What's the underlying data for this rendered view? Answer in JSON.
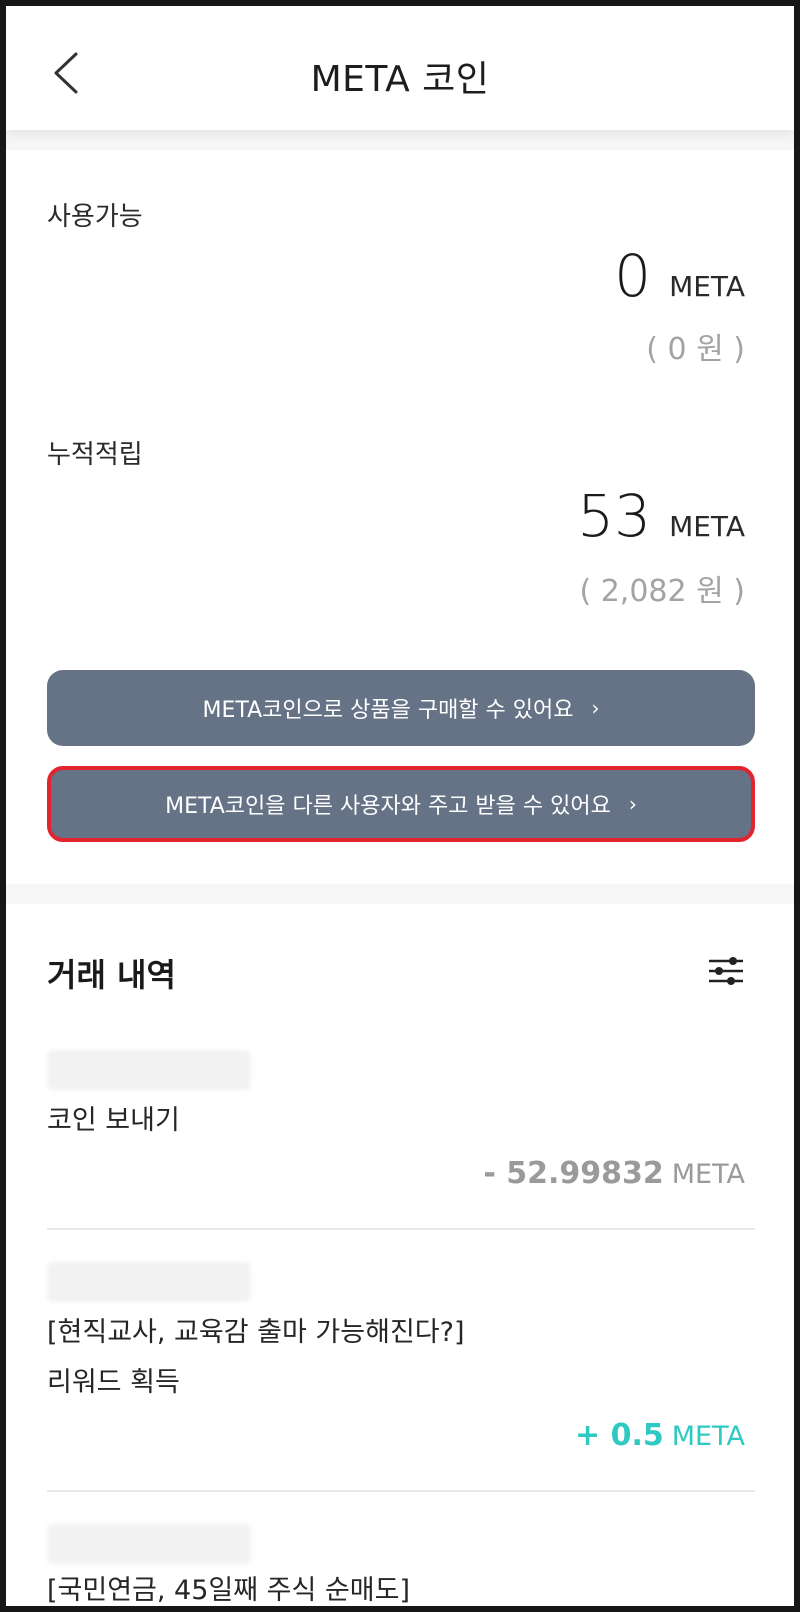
{
  "header": {
    "title": "META 코인",
    "back_icon": "chevron-left-icon"
  },
  "balance": {
    "available": {
      "label": "사용가능",
      "amount": "0",
      "unit": "META",
      "won": "( 0 원 )"
    },
    "accumulated": {
      "label": "누적적립",
      "amount": "53",
      "unit": "META",
      "won": "( 2,082 원 )"
    }
  },
  "actions": {
    "buy_label": "META코인으로 상품을 구매할 수 있어요",
    "transfer_label": "META코인을 다른 사용자와 주고 받을 수 있어요",
    "chevron": "›"
  },
  "history": {
    "title": "거래 내역",
    "filter_icon": "sliders-icon",
    "items": [
      {
        "lines": [
          "코인 보내기"
        ],
        "amount": "- 52.99832",
        "unit": "META"
      },
      {
        "lines": [
          "[현직교사, 교육감 출마 가능해진다?]",
          "리워드 획득"
        ],
        "amount": "+ 0.5",
        "unit": "META"
      },
      {
        "lines": [
          "[국민연금, 45일째 주식 순매도]"
        ]
      }
    ]
  },
  "colors": {
    "button": "#667386",
    "highlight_border": "#e3232d",
    "positive": "#2ec9c3",
    "negative": "#9a9a9a"
  }
}
